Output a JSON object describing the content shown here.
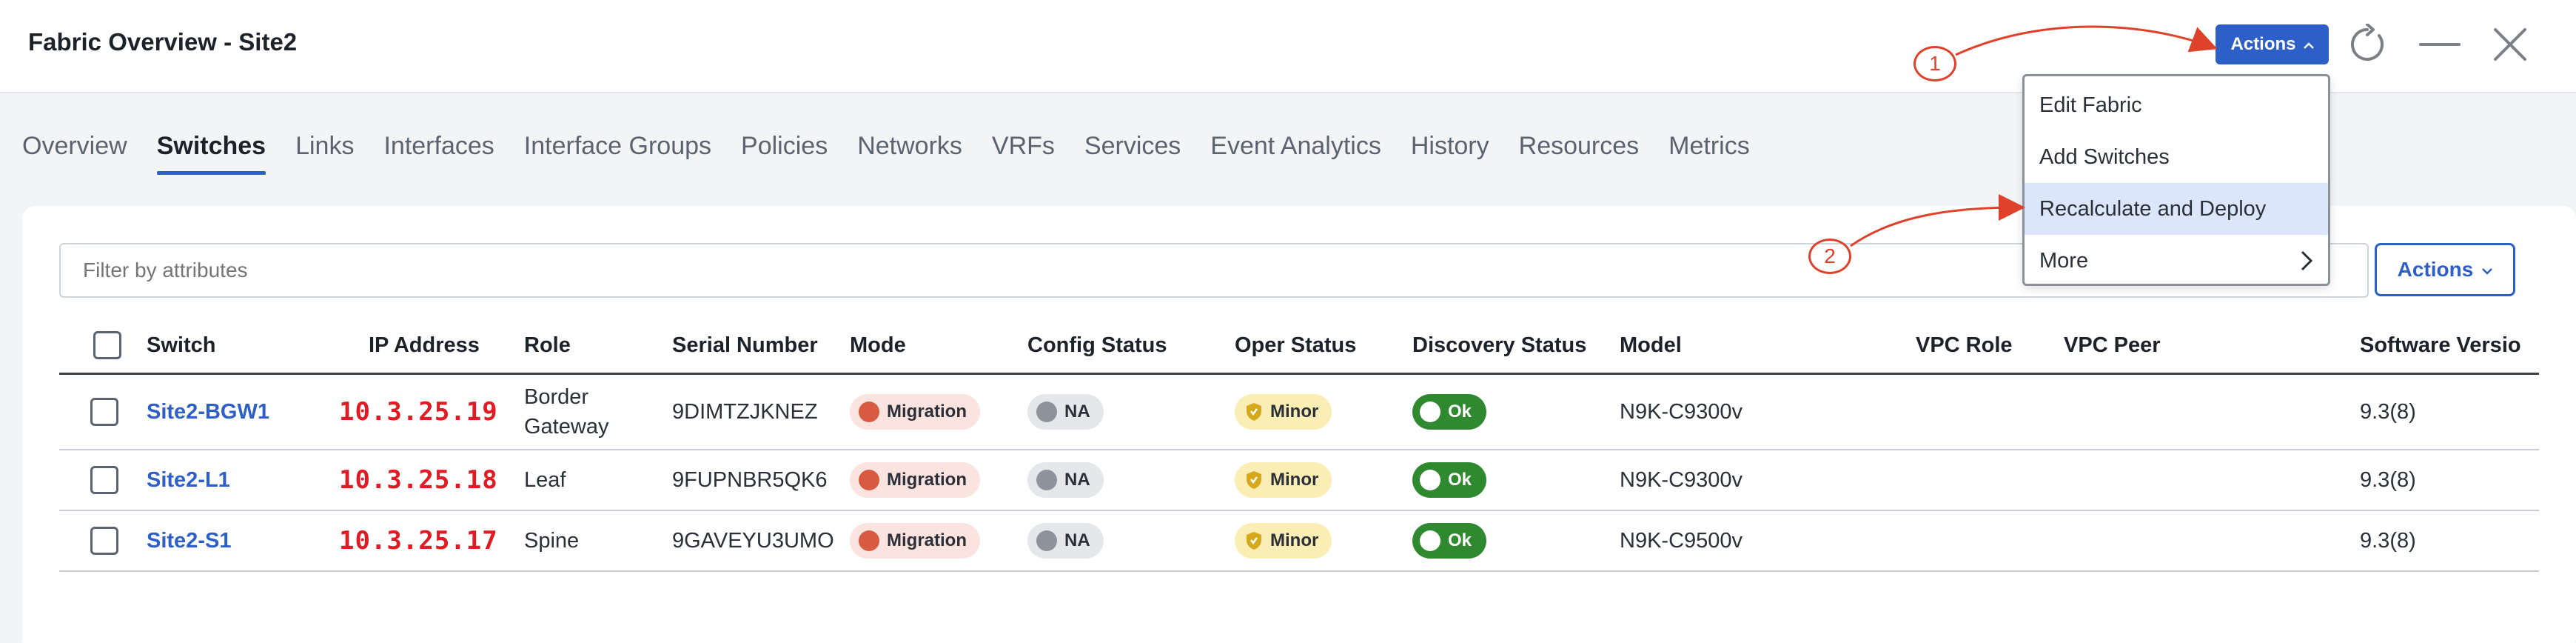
{
  "header": {
    "title": "Fabric Overview - Site2",
    "actions_label": "Actions"
  },
  "tabs": [
    {
      "label": "Overview",
      "active": false
    },
    {
      "label": "Switches",
      "active": true
    },
    {
      "label": "Links",
      "active": false
    },
    {
      "label": "Interfaces",
      "active": false
    },
    {
      "label": "Interface Groups",
      "active": false
    },
    {
      "label": "Policies",
      "active": false
    },
    {
      "label": "Networks",
      "active": false
    },
    {
      "label": "VRFs",
      "active": false
    },
    {
      "label": "Services",
      "active": false
    },
    {
      "label": "Event Analytics",
      "active": false
    },
    {
      "label": "History",
      "active": false
    },
    {
      "label": "Resources",
      "active": false
    },
    {
      "label": "Metrics",
      "active": false
    }
  ],
  "filter": {
    "placeholder": "Filter by attributes"
  },
  "card_actions_label": "Actions",
  "table": {
    "columns": [
      "Switch",
      "IP Address",
      "Role",
      "Serial Number",
      "Mode",
      "Config Status",
      "Oper Status",
      "Discovery Status",
      "Model",
      "VPC Role",
      "VPC Peer",
      "Software Versio"
    ],
    "rows": [
      {
        "switch": "Site2-BGW1",
        "ip": "10.3.25.19",
        "role": "Border Gateway",
        "serial": "9DIMTZJKNEZ",
        "mode": "Migration",
        "config": "NA",
        "oper": "Minor",
        "discovery": "Ok",
        "model": "N9K-C9300v",
        "vpc_role": "",
        "vpc_peer": "",
        "software": "9.3(8)"
      },
      {
        "switch": "Site2-L1",
        "ip": "10.3.25.18",
        "role": "Leaf",
        "serial": "9FUPNBR5QK6",
        "mode": "Migration",
        "config": "NA",
        "oper": "Minor",
        "discovery": "Ok",
        "model": "N9K-C9300v",
        "vpc_role": "",
        "vpc_peer": "",
        "software": "9.3(8)"
      },
      {
        "switch": "Site2-S1",
        "ip": "10.3.25.17",
        "role": "Spine",
        "serial": "9GAVEYU3UMO",
        "mode": "Migration",
        "config": "NA",
        "oper": "Minor",
        "discovery": "Ok",
        "model": "N9K-C9500v",
        "vpc_role": "",
        "vpc_peer": "",
        "software": "9.3(8)"
      }
    ]
  },
  "menu": {
    "items": [
      {
        "label": "Edit Fabric"
      },
      {
        "label": "Add Switches"
      },
      {
        "label": "Recalculate and Deploy"
      },
      {
        "label": "More"
      }
    ]
  },
  "annotations": [
    "1",
    "2"
  ],
  "colors": {
    "accent": "#2d5fc9",
    "ip_highlight": "#e01b24",
    "annotation": "#e0412b",
    "ok_green": "#2f8a2f",
    "minor_yellow": "#fbeeb4",
    "migration_red": "#d85a40"
  },
  "icons": {
    "header": [
      "refresh-icon",
      "minimize-icon",
      "close-icon"
    ],
    "oper_status": "shield-warning-icon",
    "discovery_status": "toggle-icon",
    "menu_more": "chevron-right-icon"
  }
}
